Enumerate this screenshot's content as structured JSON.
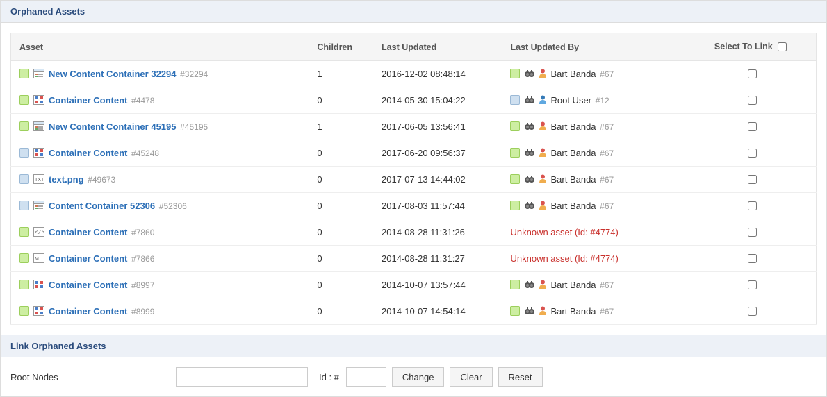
{
  "panel1": {
    "title": "Orphaned Assets"
  },
  "panel2": {
    "title": "Link Orphaned Assets"
  },
  "columns": {
    "asset": "Asset",
    "children": "Children",
    "updated": "Last Updated",
    "updated_by": "Last Updated By",
    "select": "Select To Link"
  },
  "rows": [
    {
      "status": "green",
      "type": "container",
      "name": "New Content Container 32294",
      "id": "#32294",
      "children": "1",
      "updated": "2016-12-02 08:48:14",
      "user_kind": "known",
      "user_status": "green",
      "user_name": "Bart Banda",
      "user_id": "#67"
    },
    {
      "status": "green",
      "type": "layout",
      "name": "Container Content",
      "id": "#4478",
      "children": "0",
      "updated": "2014-05-30 15:04:22",
      "user_kind": "known",
      "user_status": "blue",
      "user_name": "Root User",
      "user_id": "#12"
    },
    {
      "status": "green",
      "type": "container",
      "name": "New Content Container 45195",
      "id": "#45195",
      "children": "1",
      "updated": "2017-06-05 13:56:41",
      "user_kind": "known",
      "user_status": "green",
      "user_name": "Bart Banda",
      "user_id": "#67"
    },
    {
      "status": "blue",
      "type": "layout",
      "name": "Container Content",
      "id": "#45248",
      "children": "0",
      "updated": "2017-06-20 09:56:37",
      "user_kind": "known",
      "user_status": "green",
      "user_name": "Bart Banda",
      "user_id": "#67"
    },
    {
      "status": "blue",
      "type": "txt",
      "name": "text.png",
      "id": "#49673",
      "children": "0",
      "updated": "2017-07-13 14:44:02",
      "user_kind": "known",
      "user_status": "green",
      "user_name": "Bart Banda",
      "user_id": "#67"
    },
    {
      "status": "blue",
      "type": "container",
      "name": "Content Container 52306",
      "id": "#52306",
      "children": "0",
      "updated": "2017-08-03 11:57:44",
      "user_kind": "known",
      "user_status": "green",
      "user_name": "Bart Banda",
      "user_id": "#67"
    },
    {
      "status": "green",
      "type": "code",
      "name": "Container Content",
      "id": "#7860",
      "children": "0",
      "updated": "2014-08-28 11:31:26",
      "user_kind": "unknown",
      "unknown_text": "Unknown asset (Id: #4774)"
    },
    {
      "status": "green",
      "type": "md",
      "name": "Container Content",
      "id": "#7866",
      "children": "0",
      "updated": "2014-08-28 11:31:27",
      "user_kind": "unknown",
      "unknown_text": "Unknown asset (Id: #4774)"
    },
    {
      "status": "green",
      "type": "layout",
      "name": "Container Content",
      "id": "#8997",
      "children": "0",
      "updated": "2014-10-07 13:57:44",
      "user_kind": "known",
      "user_status": "green",
      "user_name": "Bart Banda",
      "user_id": "#67"
    },
    {
      "status": "green",
      "type": "layout",
      "name": "Container Content",
      "id": "#8999",
      "children": "0",
      "updated": "2014-10-07 14:54:14",
      "user_kind": "known",
      "user_status": "green",
      "user_name": "Bart Banda",
      "user_id": "#67"
    }
  ],
  "form": {
    "root_nodes_label": "Root Nodes",
    "id_label": "Id : #",
    "change": "Change",
    "clear": "Clear",
    "reset": "Reset"
  }
}
